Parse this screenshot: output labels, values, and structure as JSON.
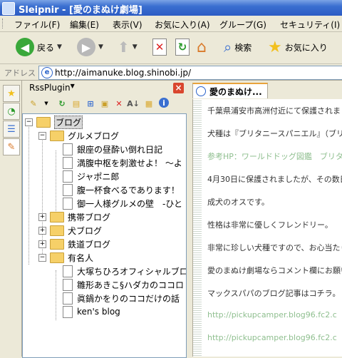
{
  "window": {
    "title": "Sleipnir - [愛のまぬけ劇場]"
  },
  "menu": [
    "ファイル(F)",
    "編集(E)",
    "表示(V)",
    "お気に入り(A)",
    "グループ(G)",
    "セキュリティ(I)"
  ],
  "toolbar": {
    "back_label": "戻る",
    "search_label": "検索",
    "favorites_label": "お気に入り"
  },
  "address": {
    "label": "アドレス",
    "url": "http://aimanuke.blog.shinobi.jp/"
  },
  "panel": {
    "title": "RssPlugin",
    "dropdown_glyph": "▼",
    "close_glyph": "×",
    "tree": {
      "root": "ブログ",
      "gourmet": {
        "label": "グルメブログ",
        "items": [
          "銀座の昼酔い倒れ日記",
          "満腹中枢を刺激せよ！ ～よ",
          "ジャポニ郎",
          "腹一杯食べるであります！",
          "御一人様グルメの壁　-ひと"
        ]
      },
      "folders": [
        "携帯ブログ",
        "犬ブログ",
        "鉄道ブログ"
      ],
      "famous": {
        "label": "有名人",
        "items": [
          "大塚ちひろオフィシャルブロ",
          "雛形あきこ§ハダカのココロ",
          "眞鍋かをりのココだけの話",
          "ken's blog"
        ]
      }
    }
  },
  "tab": {
    "label": "愛のまぬけ..."
  },
  "content": {
    "lines": [
      "千葉県浦安市高洲付近にて保護されまし",
      "犬種は『ブリタニースパニエル』（ブリ",
      "参考HP：ワールドドッグ図鑑　ブリタ",
      "4月30日に保護されましたが、その数日",
      "成犬のオスです。",
      "性格は非常に優しくフレンドリー。",
      "非常に珍しい犬種ですので、お心当たり",
      "愛のまぬけ劇場ならコメント欄にお願い",
      "マックスパパのブログ記事はコチラ。",
      "http://pickupcamper.blog96.fc2.c",
      "http://pickupcamper.blog96.fc2.c"
    ]
  },
  "colors": {
    "accent_tab": "#e8a33c",
    "link": "#8fbf8f",
    "folder": "#f6d068",
    "titlebar": "#2c5bc4"
  }
}
